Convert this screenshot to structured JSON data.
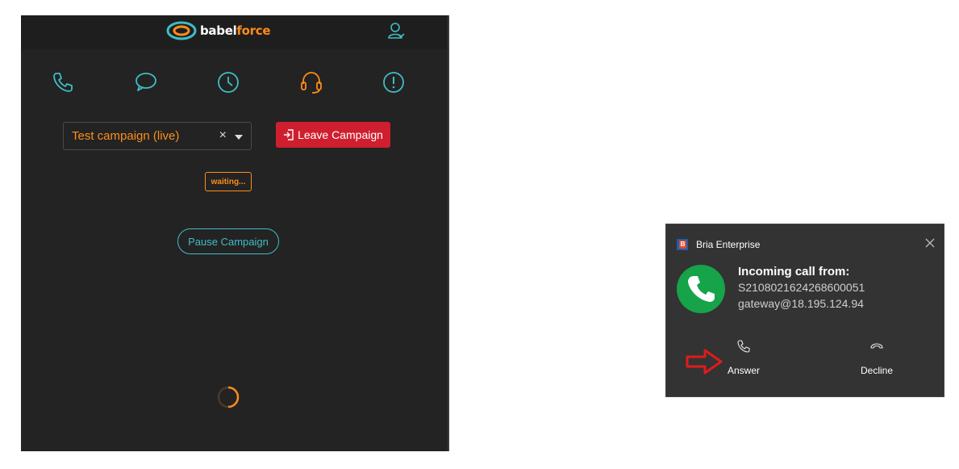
{
  "babelforce": {
    "logo": {
      "part1": "babel",
      "part2": "force"
    },
    "nav": [
      {
        "name": "phone-icon"
      },
      {
        "name": "chat-icon"
      },
      {
        "name": "clock-icon"
      },
      {
        "name": "headset-icon",
        "active": true
      },
      {
        "name": "alert-icon"
      }
    ],
    "campaign_select": {
      "value": "Test campaign (live)",
      "clear": "×"
    },
    "leave_button": "Leave Campaign",
    "status_badge": "waiting...",
    "pause_button": "Pause Campaign",
    "colors": {
      "accent": "#3fbdc6",
      "orange": "#ff8c1a",
      "danger": "#cf1f2f",
      "bg": "#232323"
    }
  },
  "bria": {
    "app_title": "Bria Enterprise",
    "heading": "Incoming call from:",
    "caller_id": "S2108021624268600051",
    "caller_address": "gateway@18.195.124.94",
    "answer_label": "Answer",
    "decline_label": "Decline",
    "colors": {
      "bg": "#333333",
      "call_green": "#16a34a",
      "arrow": "#e01b1b"
    }
  }
}
